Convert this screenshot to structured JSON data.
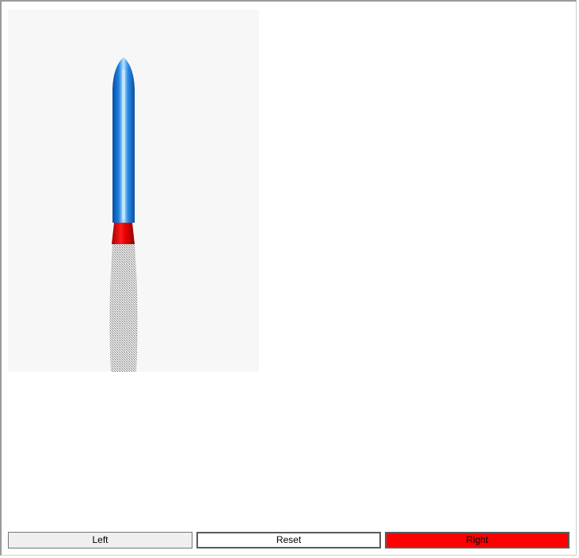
{
  "scene": {
    "background_color": "#f7f7f7",
    "rocket": {
      "body_color": "#1e7fe0",
      "nozzle_color": "#e60000",
      "exhaust_color": "#9a9a9a"
    }
  },
  "controls": {
    "left_label": "Left",
    "reset_label": "Reset",
    "right_label": "Right",
    "right_color": "#ff0000"
  }
}
